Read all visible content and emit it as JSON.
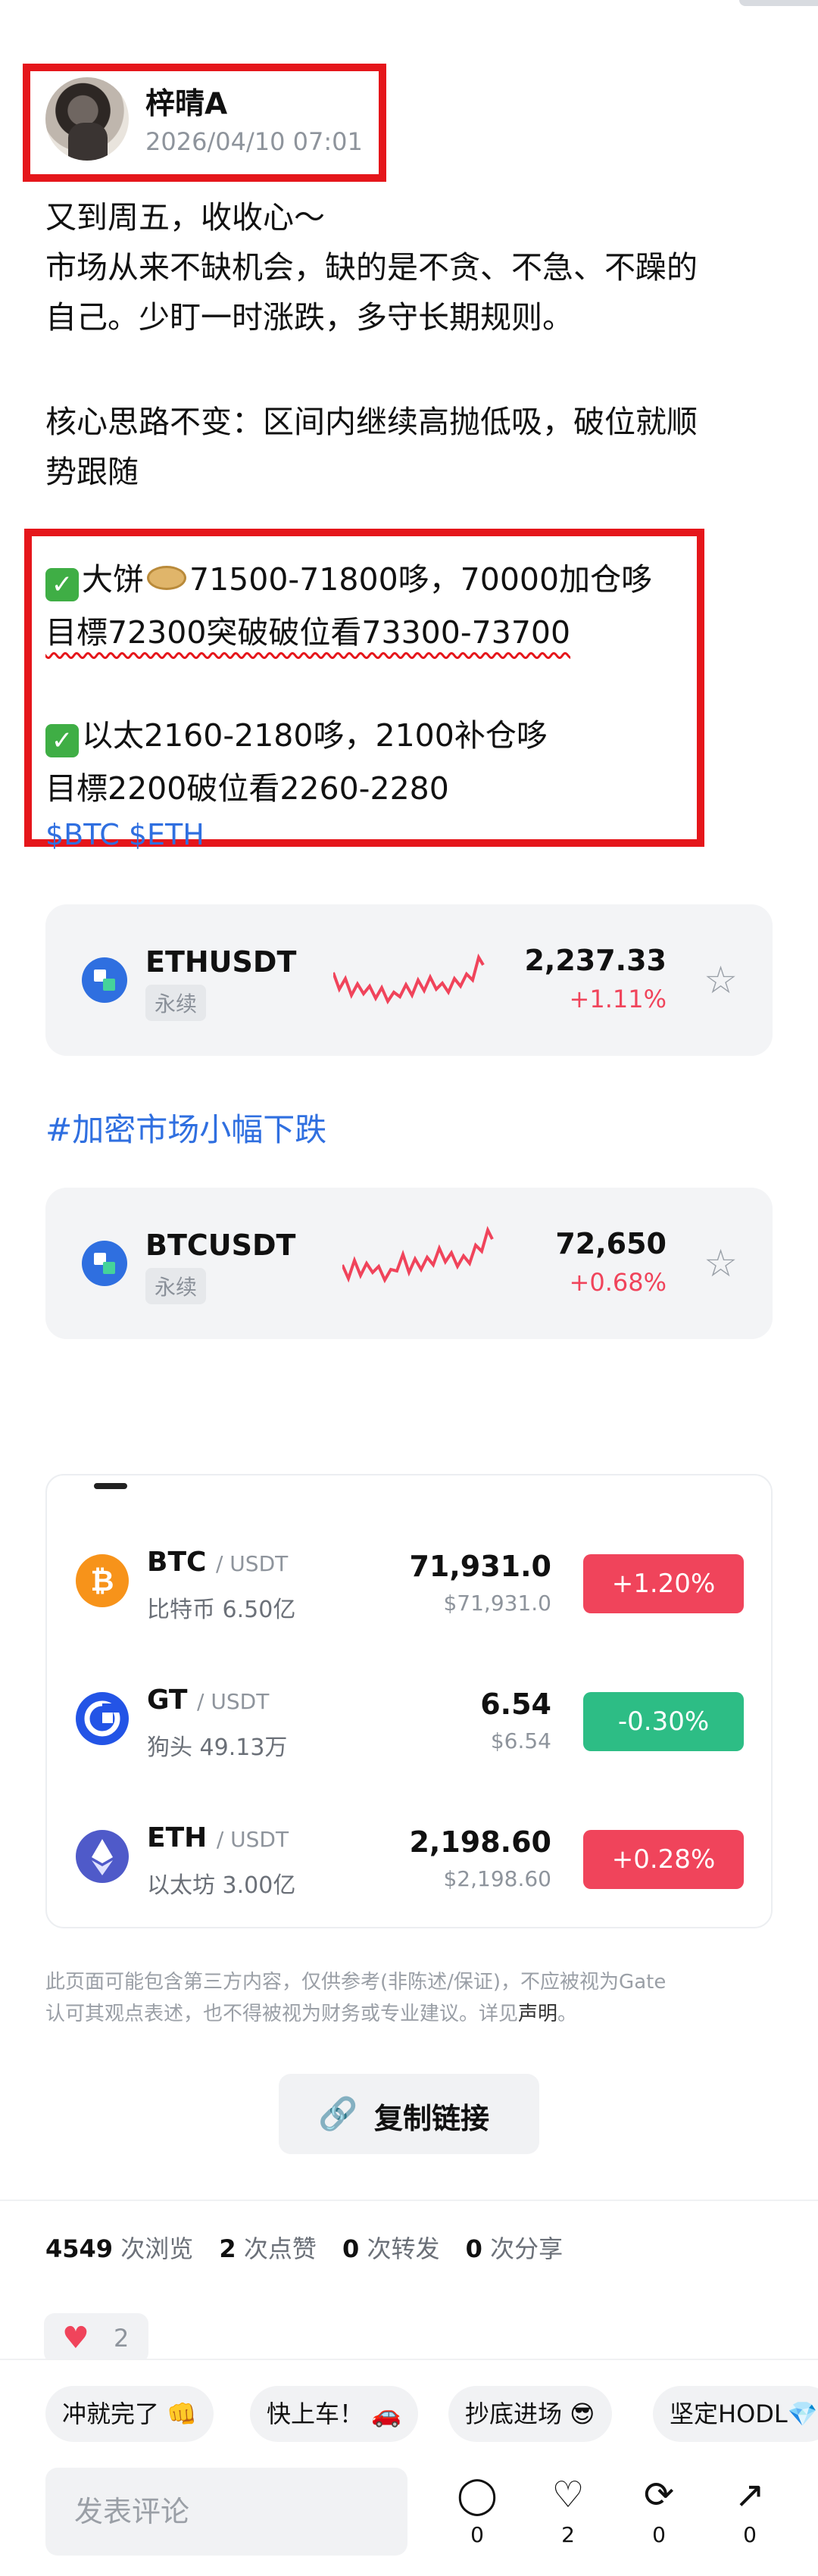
{
  "author": {
    "name": "梓晴A",
    "time": "2026/04/10 07:01"
  },
  "post": {
    "lines1": [
      "又到周五，收收心～",
      "市场从来不缺机会，缺的是不贪、不急、不躁的",
      "自己。少盯一时涨跌，多守长期规则。"
    ],
    "line_core1": "核心思路不变：区间内继续高抛低吸，破位就顺",
    "line_core2": "势跟随",
    "btc_l1_a": "大饼",
    "btc_l1_b": "71500-71800哆，70000加仓哆",
    "btc_l2": "目標72300突破破位看73300-73700",
    "eth_l1": "以太2160-2180哆，2100补仓哆",
    "eth_l2": "目標2200破位看2260-2280",
    "tags": "$BTC $ETH"
  },
  "tickers": [
    {
      "symbol": "ETHUSDT",
      "type": "永续",
      "price": "2,237.33",
      "change": "+1.11%"
    },
    {
      "symbol": "BTCUSDT",
      "type": "永续",
      "price": "72,650",
      "change": "+0.68%"
    }
  ],
  "hashtag": "#加密市场小幅下跌",
  "market": [
    {
      "symbol": "BTC",
      "quote": "/ USDT",
      "name": "比特币",
      "volume": "6.50亿",
      "price": "71,931.0",
      "usd": "$71,931.0",
      "change": "+1.20%",
      "color": "#f0445b",
      "icon": "btc-icon"
    },
    {
      "symbol": "GT",
      "quote": "/ USDT",
      "name": "狗头",
      "volume": "49.13万",
      "price": "6.54",
      "usd": "$6.54",
      "change": "-0.30%",
      "color": "#2dbd85",
      "icon": "gt-icon"
    },
    {
      "symbol": "ETH",
      "quote": "/ USDT",
      "name": "以太坊",
      "volume": "3.00亿",
      "price": "2,198.60",
      "usd": "$2,198.60",
      "change": "+0.28%",
      "color": "#f0445b",
      "icon": "eth-icon"
    }
  ],
  "disclaimer": {
    "text1": "此页面可能包含第三方内容，仅供参考(非陈述/保证)，不应被视为Gate",
    "text2": "认可其观点表述，也不得被视为财务或专业建议。详见",
    "link": "声明",
    "end": "。"
  },
  "copy_link": "复制链接",
  "stats": {
    "views": "4549",
    "views_label": "次浏览",
    "likes": "2",
    "likes_label": "次点赞",
    "reposts": "0",
    "reposts_label": "次转发",
    "shares": "0",
    "shares_label": "次分享"
  },
  "like_chip": {
    "count": "2"
  },
  "quick_replies": [
    "冲就完了 👊",
    "快上车！ 🚗",
    "抄底进场 😎",
    "坚定HODL💎"
  ],
  "comment_placeholder": "发表评论",
  "actions": {
    "comments": "0",
    "likes": "2",
    "reposts": "0",
    "shares": "0"
  }
}
